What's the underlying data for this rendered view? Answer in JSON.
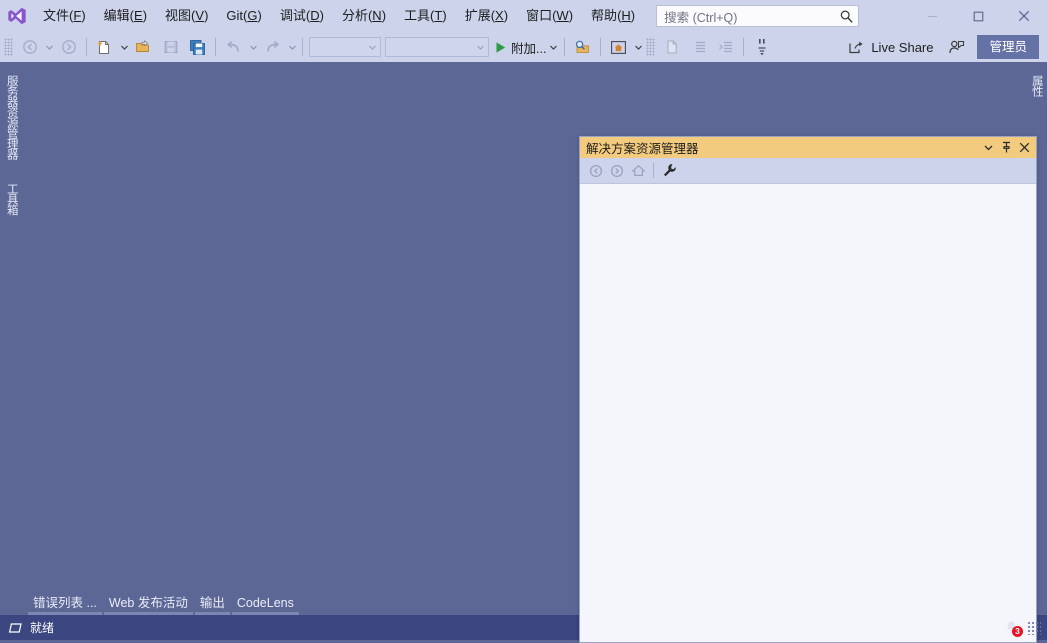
{
  "app": {
    "logo_icon": "visual-studio-logo",
    "background_color": "#5c6796",
    "chrome_color": "#ccd3ea",
    "accent_color": "#f3cb7f",
    "status_color": "#3c4680"
  },
  "menubar": {
    "items": [
      {
        "label": "文件",
        "mnemonic": "F"
      },
      {
        "label": "编辑",
        "mnemonic": "E"
      },
      {
        "label": "视图",
        "mnemonic": "V"
      },
      {
        "label": "Git",
        "mnemonic": "G"
      },
      {
        "label": "调试",
        "mnemonic": "D"
      },
      {
        "label": "分析",
        "mnemonic": "N"
      },
      {
        "label": "工具",
        "mnemonic": "T"
      },
      {
        "label": "扩展",
        "mnemonic": "X"
      },
      {
        "label": "窗口",
        "mnemonic": "W"
      },
      {
        "label": "帮助",
        "mnemonic": "H"
      }
    ]
  },
  "search": {
    "placeholder": "搜索 (Ctrl+Q)",
    "value": "",
    "icon": "search-icon"
  },
  "window_controls": {
    "minimize": "minimize-icon",
    "maximize": "maximize-icon",
    "close": "close-icon"
  },
  "toolbar": {
    "nav_back": "navigate-back-icon",
    "nav_forward": "navigate-forward-icon",
    "new_project": "new-project-icon",
    "open_folder": "open-folder-icon",
    "save": "save-icon",
    "save_all": "save-all-icon",
    "undo": "undo-icon",
    "redo": "redo-icon",
    "config_combo_value": "",
    "platform_combo_value": "",
    "attach_label": "附加...",
    "attach_icon": "run-play-icon",
    "find_icon": "find-in-files-icon",
    "home_icon": "home-boxed-icon",
    "new_file_icon": "new-file-icon",
    "indent_icon": "indent-icon",
    "outdent_icon": "outdent-icon",
    "quote_icon": "comment-icon",
    "live_share_label": "Live Share",
    "live_share_icon": "live-share-icon",
    "feedback_icon": "send-feedback-icon",
    "admin_label": "管理员"
  },
  "dock_tabs": {
    "left": [
      {
        "label": "服务器资源管理器"
      },
      {
        "label": "工具箱"
      }
    ],
    "right": [
      {
        "label": "属性"
      }
    ]
  },
  "tool_window": {
    "title": "解决方案资源管理器",
    "dropdown_icon": "chevron-down-icon",
    "pin_icon": "pin-icon",
    "close_icon": "close-icon",
    "toolbar": {
      "back_icon": "back-circle-icon",
      "forward_icon": "forward-circle-icon",
      "home_icon": "home-icon",
      "properties_icon": "wrench-icon"
    },
    "content": ""
  },
  "bottom_tabs": [
    {
      "label": "错误列表 ..."
    },
    {
      "label": "Web 发布活动"
    },
    {
      "label": "输出"
    },
    {
      "label": "CodeLens"
    }
  ],
  "statusbar": {
    "icon": "ready-shape-icon",
    "text": "就绪",
    "bell_icon": "notification-bell-icon",
    "bell_count": "3",
    "resize_grip": "resize-grip-icon"
  }
}
